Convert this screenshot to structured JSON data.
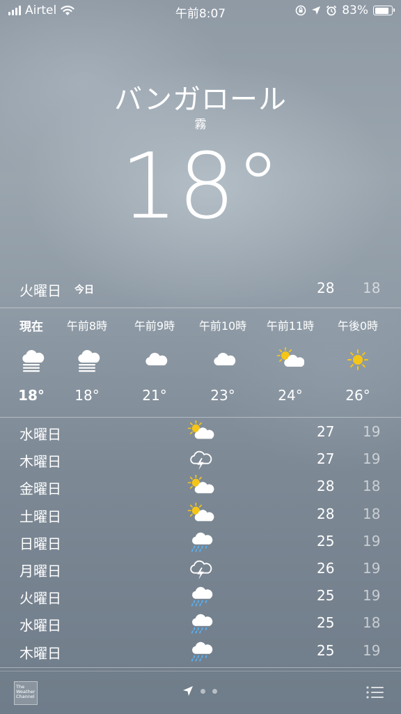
{
  "status": {
    "carrier": "Airtel",
    "time": "午前8:07",
    "battery": "83%"
  },
  "header": {
    "city": "バンガロール",
    "condition": "霧",
    "temperature": "18°"
  },
  "today": {
    "day": "火曜日",
    "tag": "今日",
    "high": "28",
    "low": "18"
  },
  "hourly": [
    {
      "time": "現在",
      "icon": "fog-icon",
      "temp": "18°"
    },
    {
      "time": "午前8時",
      "icon": "fog-icon",
      "temp": "18°"
    },
    {
      "time": "午前9時",
      "icon": "cloud-icon",
      "temp": "21°"
    },
    {
      "time": "午前10時",
      "icon": "cloud-icon",
      "temp": "23°"
    },
    {
      "time": "午前11時",
      "icon": "partly-sunny-icon",
      "temp": "24°"
    },
    {
      "time": "午後0時",
      "icon": "sun-icon",
      "temp": "26°"
    }
  ],
  "daily": [
    {
      "day": "水曜日",
      "icon": "partly-sunny-icon",
      "high": "27",
      "low": "19"
    },
    {
      "day": "木曜日",
      "icon": "thunderstorm-icon",
      "high": "27",
      "low": "19"
    },
    {
      "day": "金曜日",
      "icon": "partly-sunny-icon",
      "high": "28",
      "low": "18"
    },
    {
      "day": "土曜日",
      "icon": "partly-sunny-icon",
      "high": "28",
      "low": "18"
    },
    {
      "day": "日曜日",
      "icon": "rain-icon",
      "high": "25",
      "low": "19"
    },
    {
      "day": "月曜日",
      "icon": "thunderstorm-icon",
      "high": "26",
      "low": "19"
    },
    {
      "day": "火曜日",
      "icon": "rain-icon",
      "high": "25",
      "low": "19"
    },
    {
      "day": "水曜日",
      "icon": "rain-icon",
      "high": "25",
      "low": "18"
    },
    {
      "day": "木曜日",
      "icon": "rain-icon",
      "high": "25",
      "low": "19"
    }
  ],
  "footer": {
    "logo_text": "The Weather Channel",
    "location_icon": "location-arrow-icon",
    "list_icon": "list-icon"
  },
  "colors": {
    "sun": "#f5c518",
    "rain": "#5ab0f0"
  }
}
